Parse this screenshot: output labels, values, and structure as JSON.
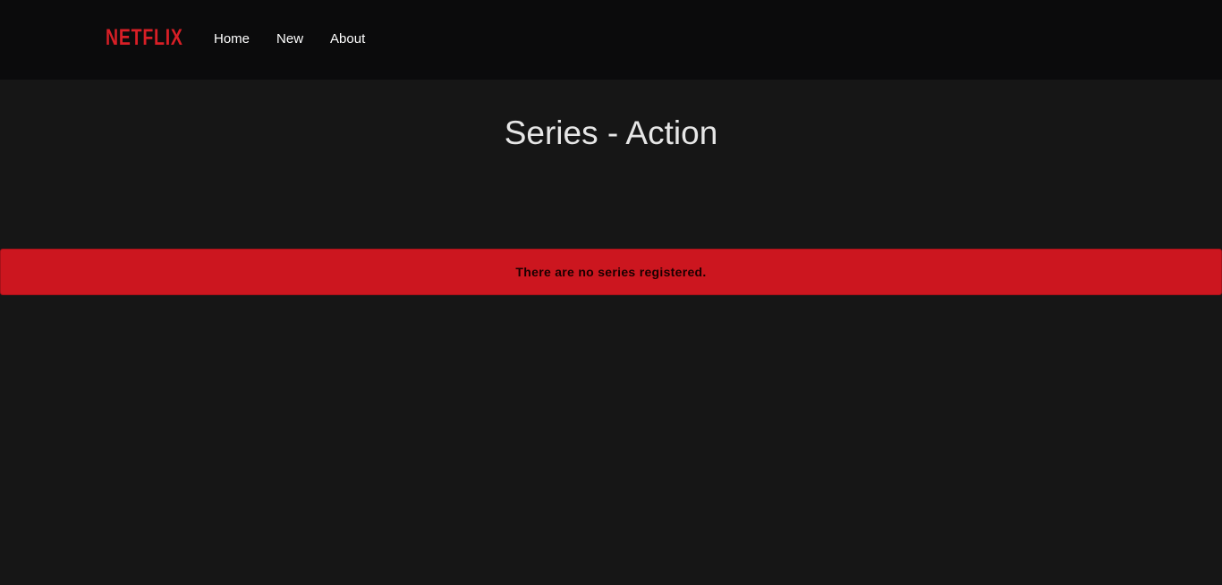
{
  "navbar": {
    "logo_text": "NETFLIX",
    "links": [
      {
        "label": "Home"
      },
      {
        "label": "New"
      },
      {
        "label": "About"
      }
    ]
  },
  "main": {
    "title": "Series - Action",
    "alert_message": "There are no series registered."
  },
  "colors": {
    "brand": "#d81f26",
    "alert_background": "#cc161f",
    "background": "#161616",
    "navbar_background": "#0b0b0c"
  }
}
